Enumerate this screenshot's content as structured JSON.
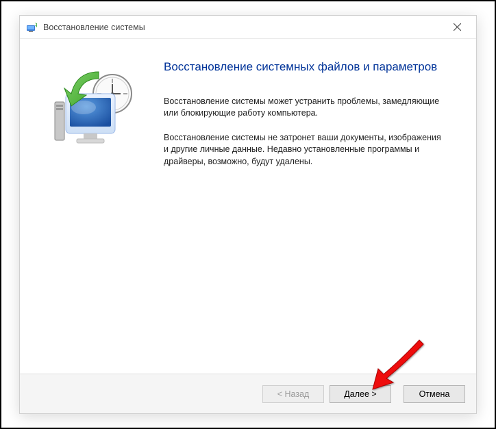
{
  "title": "Восстановление системы",
  "heading": "Восстановление системных файлов и параметров",
  "paragraph1": "Восстановление системы может устранить проблемы, замедляющие или блокирующие работу компьютера.",
  "paragraph2": "Восстановление системы не затронет ваши документы, изображения и другие личные данные. Недавно установленные программы и драйверы, возможно, будут удалены.",
  "buttons": {
    "back": "< Назад",
    "next": "Далее >",
    "cancel": "Отмена"
  }
}
